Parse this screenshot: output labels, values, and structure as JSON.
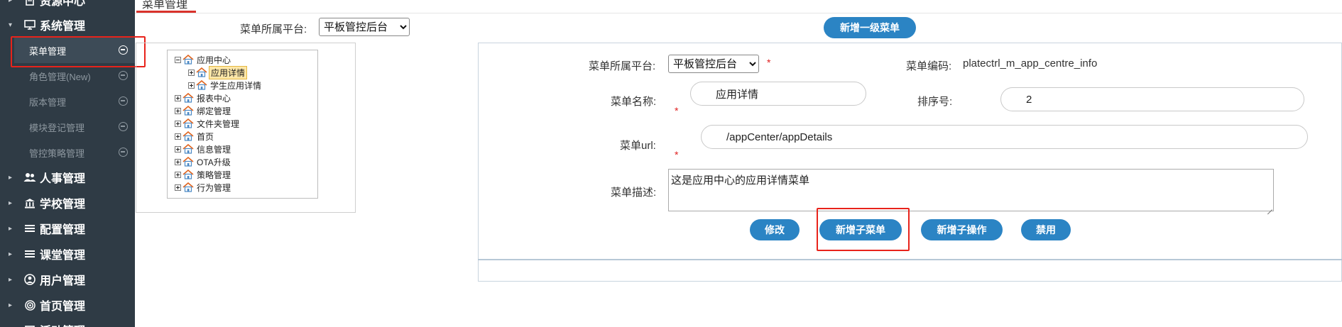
{
  "sidebar": {
    "groups": [
      {
        "label": "资源中心",
        "icon": "document-icon",
        "arrow": "▸"
      },
      {
        "label": "系统管理",
        "icon": "monitor-icon",
        "arrow": "▾"
      },
      {
        "label": "人事管理",
        "icon": "users-icon",
        "arrow": "▸"
      },
      {
        "label": "学校管理",
        "icon": "bank-icon",
        "arrow": "▸"
      },
      {
        "label": "配置管理",
        "icon": "list-icon",
        "arrow": "▸"
      },
      {
        "label": "课堂管理",
        "icon": "list-icon",
        "arrow": "▸"
      },
      {
        "label": "用户管理",
        "icon": "user-circle-icon",
        "arrow": "▸"
      },
      {
        "label": "首页管理",
        "icon": "target-icon",
        "arrow": "▸"
      },
      {
        "label": "活动管理",
        "icon": "calendar-icon",
        "arrow": "▸"
      }
    ],
    "sub_items": [
      {
        "label": "菜单管理",
        "active": true
      },
      {
        "label": "角色管理(New)",
        "active": false
      },
      {
        "label": "版本管理",
        "active": false
      },
      {
        "label": "模块登记管理",
        "active": false
      },
      {
        "label": "管控策略管理",
        "active": false
      }
    ]
  },
  "tab": {
    "label": "菜单管理"
  },
  "left_panel": {
    "platform_label": "菜单所属平台:",
    "platform_value": "平板管控后台",
    "tree": [
      {
        "label": "应用中心",
        "expanded": true,
        "level": 0
      },
      {
        "label": "应用详情",
        "expanded": false,
        "level": 1,
        "selected": true
      },
      {
        "label": "学生应用详情",
        "expanded": false,
        "level": 1
      },
      {
        "label": "报表中心",
        "expanded": false,
        "level": 0
      },
      {
        "label": "绑定管理",
        "expanded": false,
        "level": 0
      },
      {
        "label": "文件夹管理",
        "expanded": false,
        "level": 0
      },
      {
        "label": "首页",
        "expanded": false,
        "level": 0
      },
      {
        "label": "信息管理",
        "expanded": false,
        "level": 0
      },
      {
        "label": "OTA升级",
        "expanded": false,
        "level": 0
      },
      {
        "label": "策略管理",
        "expanded": false,
        "level": 0
      },
      {
        "label": "行为管理",
        "expanded": false,
        "level": 0
      }
    ]
  },
  "toolbar": {
    "add_top_menu": "新增一级菜单"
  },
  "form": {
    "platform_label": "菜单所属平台:",
    "platform_value": "平板管控后台",
    "required_mark": "*",
    "code_label": "菜单编码:",
    "code_value": "platectrl_m_app_centre_info",
    "name_label": "菜单名称:",
    "name_value": "应用详情",
    "order_label": "排序号:",
    "order_value": "2",
    "url_label": "菜单url:",
    "url_value": "/appCenter/appDetails",
    "desc_label": "菜单描述:",
    "desc_value": "这是应用中心的应用详情菜单",
    "buttons": {
      "modify": "修改",
      "add_sub_menu": "新增子菜单",
      "add_sub_action": "新增子操作",
      "disable": "禁用"
    }
  },
  "colors": {
    "sidebar_bg": "#2f3b45",
    "button_blue": "#2b84c4",
    "highlight_red": "#e8231b",
    "required_red": "#e02020"
  }
}
